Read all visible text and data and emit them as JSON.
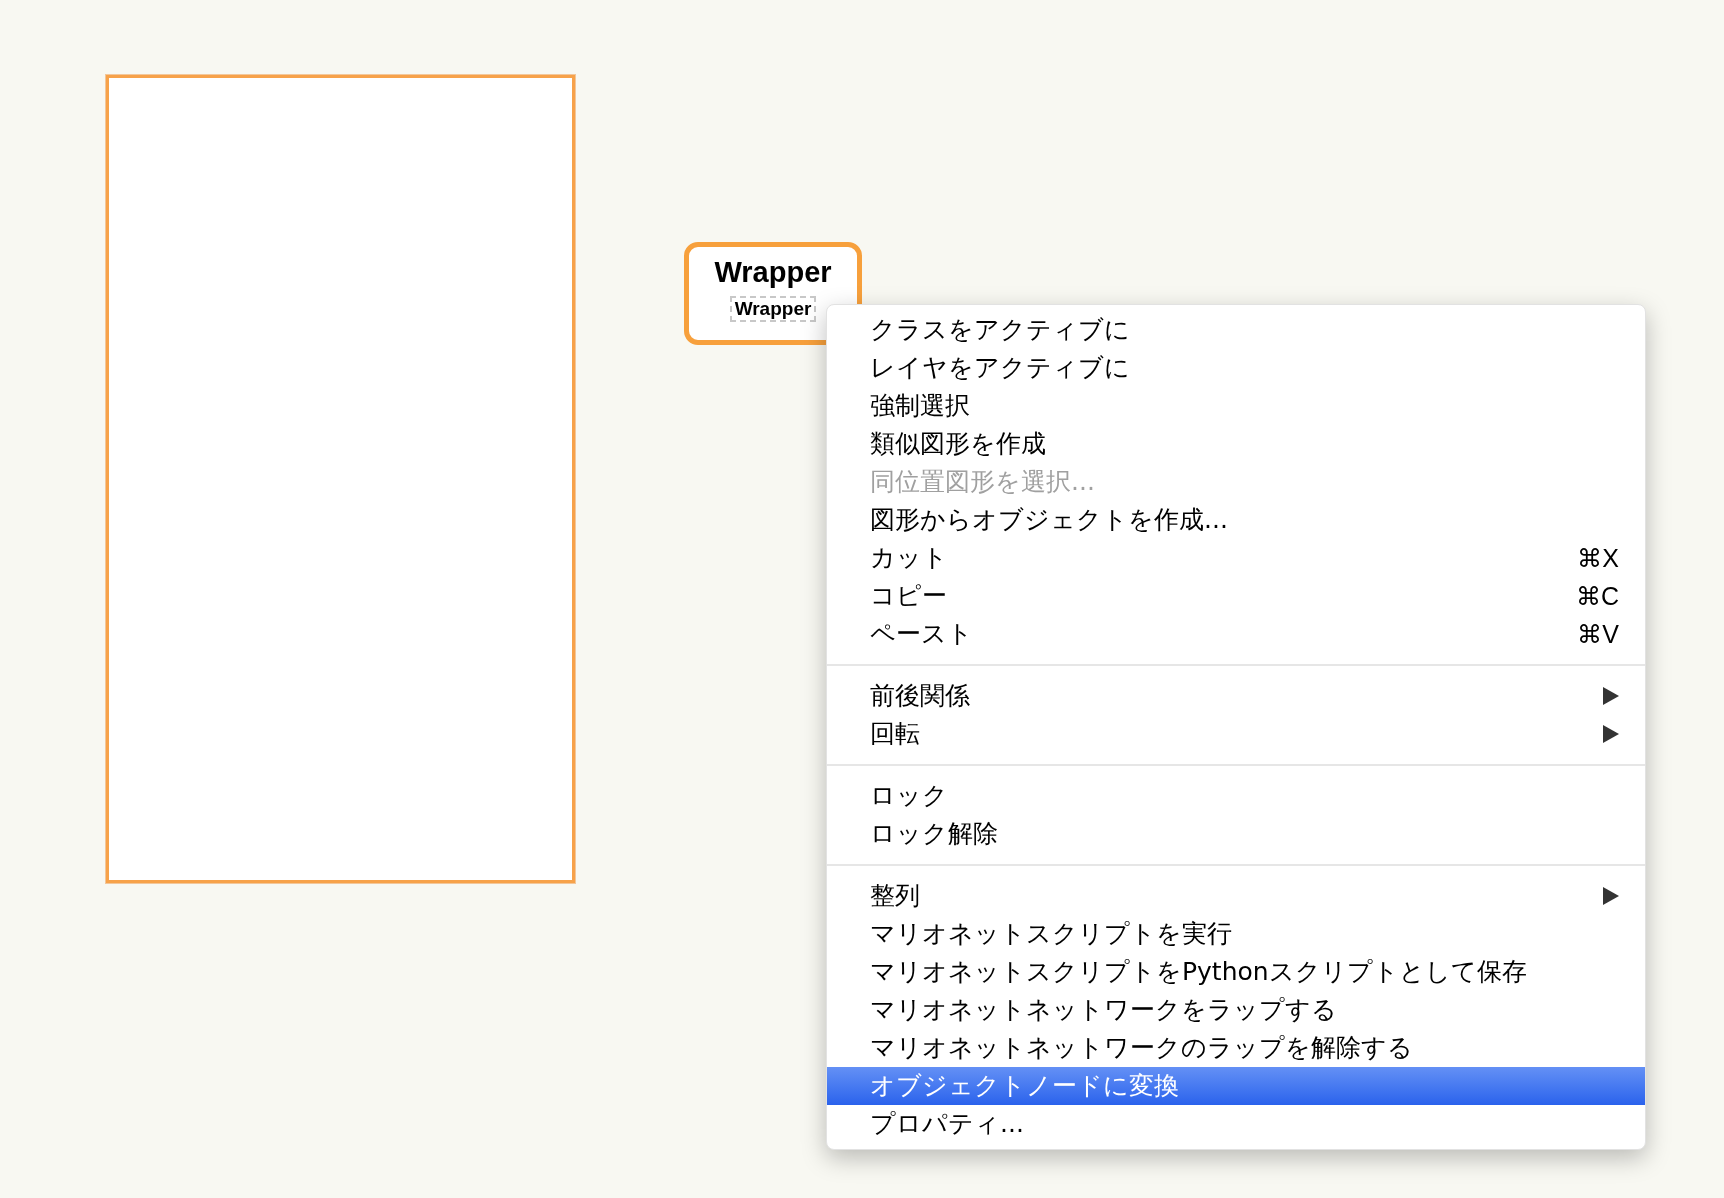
{
  "canvas": {
    "node": {
      "title": "Wrapper",
      "label": "Wrapper"
    }
  },
  "context_menu": {
    "sections": [
      {
        "items": [
          {
            "label": "クラスをアクティブに",
            "disabled": false,
            "selected": false,
            "has_submenu": false
          },
          {
            "label": "レイヤをアクティブに",
            "disabled": false,
            "selected": false,
            "has_submenu": false
          },
          {
            "label": "強制選択",
            "disabled": false,
            "selected": false,
            "has_submenu": false
          },
          {
            "label": "類似図形を作成",
            "disabled": false,
            "selected": false,
            "has_submenu": false
          },
          {
            "label": "同位置図形を選択...",
            "disabled": true,
            "selected": false,
            "has_submenu": false
          },
          {
            "label": "図形からオブジェクトを作成...",
            "disabled": false,
            "selected": false,
            "has_submenu": false
          },
          {
            "label": "カット",
            "shortcut": "⌘X",
            "disabled": false,
            "selected": false,
            "has_submenu": false
          },
          {
            "label": "コピー",
            "shortcut": "⌘C",
            "disabled": false,
            "selected": false,
            "has_submenu": false
          },
          {
            "label": "ペースト",
            "shortcut": "⌘V",
            "disabled": false,
            "selected": false,
            "has_submenu": false
          }
        ]
      },
      {
        "items": [
          {
            "label": "前後関係",
            "disabled": false,
            "selected": false,
            "has_submenu": true
          },
          {
            "label": "回転",
            "disabled": false,
            "selected": false,
            "has_submenu": true
          }
        ]
      },
      {
        "items": [
          {
            "label": "ロック",
            "disabled": false,
            "selected": false,
            "has_submenu": false
          },
          {
            "label": "ロック解除",
            "disabled": false,
            "selected": false,
            "has_submenu": false
          }
        ]
      },
      {
        "items": [
          {
            "label": "整列",
            "disabled": false,
            "selected": false,
            "has_submenu": true
          },
          {
            "label": "マリオネットスクリプトを実行",
            "disabled": false,
            "selected": false,
            "has_submenu": false
          },
          {
            "label": "マリオネットスクリプトをPythonスクリプトとして保存",
            "disabled": false,
            "selected": false,
            "has_submenu": false
          },
          {
            "label": "マリオネットネットワークをラップする",
            "disabled": false,
            "selected": false,
            "has_submenu": false
          },
          {
            "label": "マリオネットネットワークのラップを解除する",
            "disabled": false,
            "selected": false,
            "has_submenu": false
          },
          {
            "label": "オブジェクトノードに変換",
            "disabled": false,
            "selected": true,
            "has_submenu": false
          },
          {
            "label": "プロパティ...",
            "disabled": false,
            "selected": false,
            "has_submenu": false
          }
        ]
      }
    ]
  }
}
